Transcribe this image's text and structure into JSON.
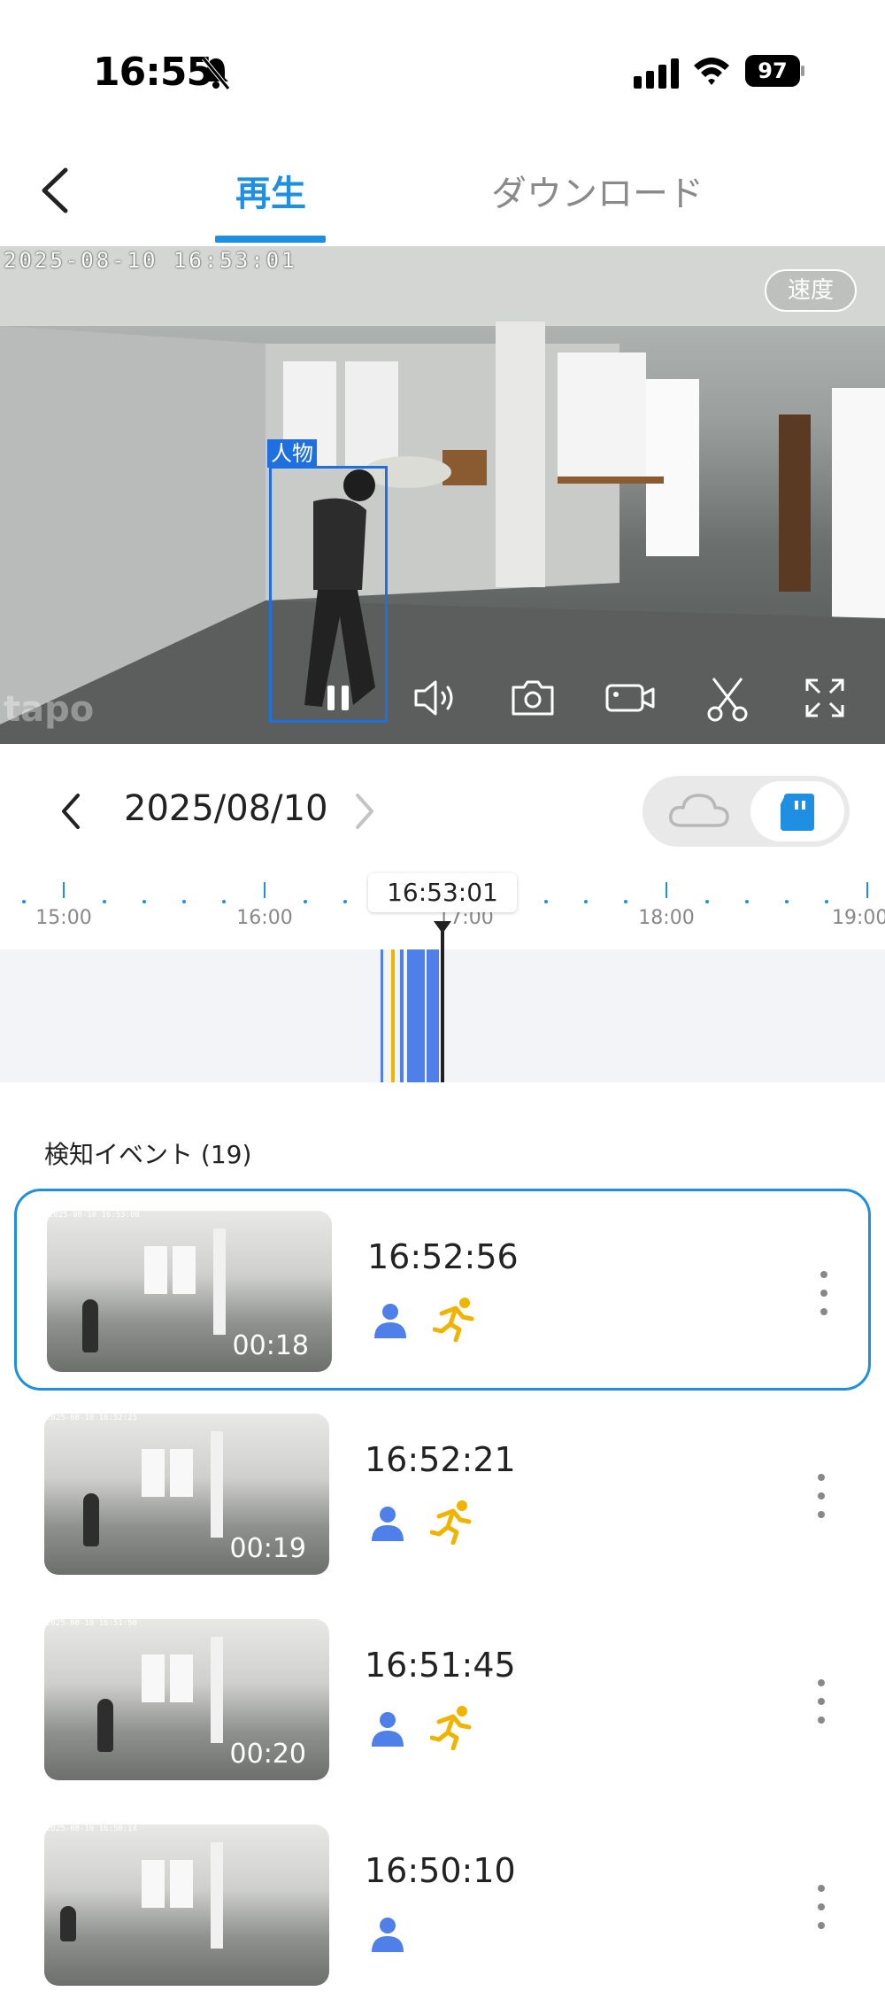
{
  "status_bar": {
    "time": "16:55",
    "battery": "97"
  },
  "header": {
    "tab_play": "再生",
    "tab_download": "ダウンロード"
  },
  "video": {
    "timestamp": "2025-08-10  16:53:01",
    "speed_label": "速度",
    "detection_label": "人物",
    "watermark": "tapo",
    "controls": [
      "pause-icon",
      "volume-icon",
      "camera-icon",
      "record-icon",
      "scissors-icon",
      "fullscreen-icon"
    ]
  },
  "date_nav": {
    "date": "2025/08/10"
  },
  "timeline": {
    "current_time": "16:53:01",
    "labels": [
      "15:00",
      "16:00",
      "17:00",
      "18:00",
      "19:00"
    ],
    "accent": "#1e8fe1",
    "person_color": "#4f7fe8",
    "motion_color": "#f0b400"
  },
  "events": {
    "title": "検知イベント (19)",
    "items": [
      {
        "time": "16:52:56",
        "duration": "00:18",
        "thumb_ts": "2025-08-10 16:53:00",
        "selected": true
      },
      {
        "time": "16:52:21",
        "duration": "00:19",
        "thumb_ts": "2025-08-10 16:52:25",
        "selected": false
      },
      {
        "time": "16:51:45",
        "duration": "00:20",
        "thumb_ts": "2025-08-10 16:51:50",
        "selected": false
      },
      {
        "time": "16:50:10",
        "duration": "",
        "thumb_ts": "2025-08-10 16:50:14",
        "selected": false
      }
    ]
  }
}
